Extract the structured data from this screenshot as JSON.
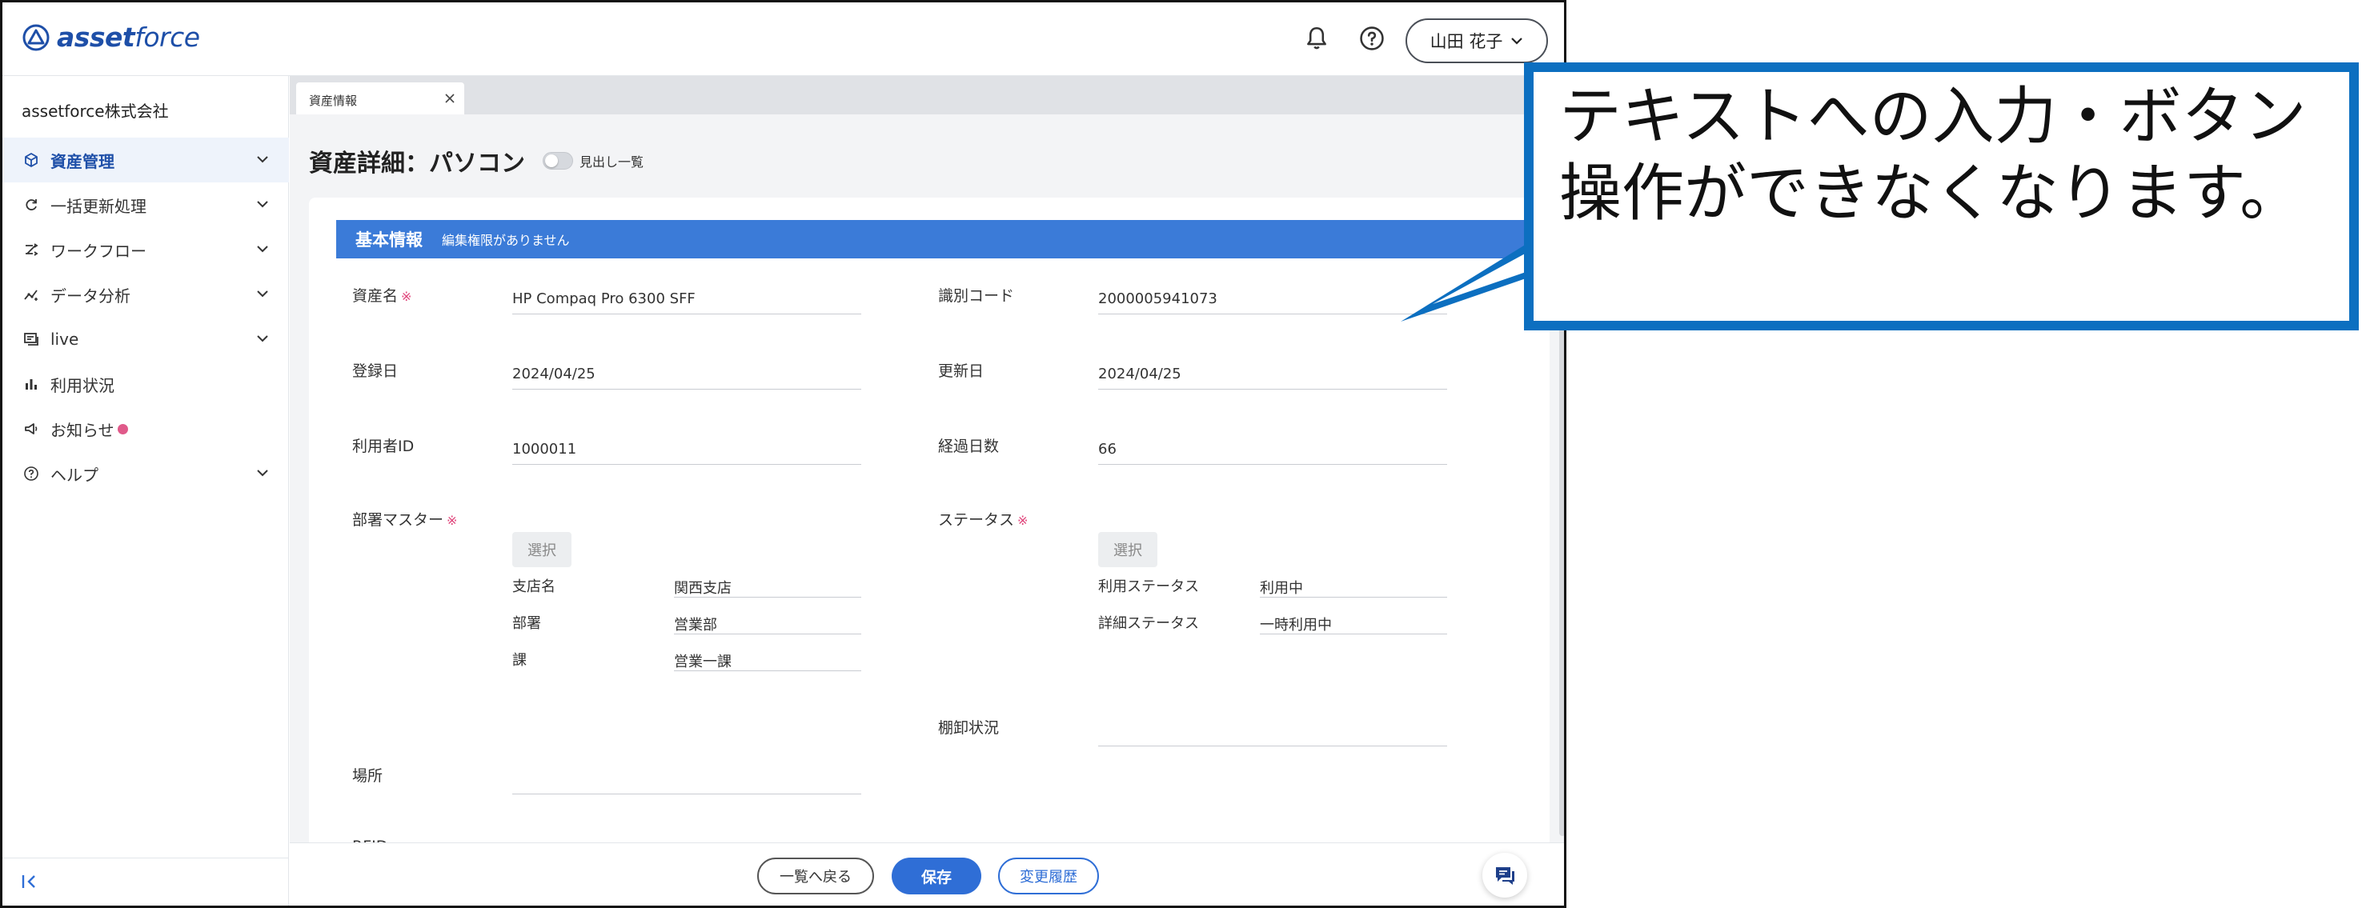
{
  "brand": {
    "name_bold": "asset",
    "name_light": "force"
  },
  "header": {
    "user_name": "山田 花子"
  },
  "sidebar": {
    "company": "assetforce株式会社",
    "items": [
      {
        "label": "資産管理",
        "icon": "box-icon",
        "expandable": true,
        "active": true
      },
      {
        "label": "一括更新処理",
        "icon": "refresh-icon",
        "expandable": true
      },
      {
        "label": "ワークフロー",
        "icon": "workflow-icon",
        "expandable": true
      },
      {
        "label": "データ分析",
        "icon": "analytics-icon",
        "expandable": true
      },
      {
        "label": "live",
        "icon": "live-icon",
        "expandable": true
      },
      {
        "label": "利用状況",
        "icon": "bar-chart-icon",
        "expandable": false
      },
      {
        "label": "お知らせ",
        "icon": "megaphone-icon",
        "expandable": false,
        "badge": true
      },
      {
        "label": "ヘルプ",
        "icon": "help-icon",
        "expandable": true
      }
    ]
  },
  "tab": {
    "label": "資産情報"
  },
  "page": {
    "title": "資産詳細：パソコン",
    "toggle_label": "見出し一覧"
  },
  "section": {
    "title": "基本情報",
    "note": "編集権限がありません"
  },
  "fields": {
    "asset_name": {
      "label": "資産名",
      "value": "HP Compaq Pro 6300 SFF",
      "required": "※"
    },
    "id_code": {
      "label": "識別コード",
      "value": "2000005941073"
    },
    "registered": {
      "label": "登録日",
      "value": "2024/04/25"
    },
    "updated": {
      "label": "更新日",
      "value": "2024/04/25"
    },
    "user_id": {
      "label": "利用者ID",
      "value": "1000011"
    },
    "elapsed_days": {
      "label": "経過日数",
      "value": "66"
    },
    "dept_master": {
      "label": "部署マスター",
      "required": "※",
      "select_label": "選択",
      "rows": [
        {
          "label": "支店名",
          "value": "関西支店"
        },
        {
          "label": "部署",
          "value": "営業部"
        },
        {
          "label": "課",
          "value": "営業一課"
        }
      ]
    },
    "status": {
      "label": "ステータス",
      "required": "※",
      "select_label": "選択",
      "rows": [
        {
          "label": "利用ステータス",
          "value": "利用中"
        },
        {
          "label": "詳細ステータス",
          "value": "一時利用中"
        }
      ]
    },
    "inventory": {
      "label": "棚卸状況",
      "value": ""
    },
    "location": {
      "label": "場所",
      "value": ""
    },
    "rfid": {
      "label": "RFID"
    }
  },
  "footer": {
    "back": "一覧へ戻る",
    "save": "保存",
    "history": "変更履歴"
  },
  "callout": {
    "text": "テキストへの入力・ボタン操作ができなくなります。"
  },
  "colors": {
    "accent": "#3b7bd8",
    "primary": "#2f6ed6",
    "callout_border": "#0c6fc0",
    "required": "#e0457b"
  }
}
